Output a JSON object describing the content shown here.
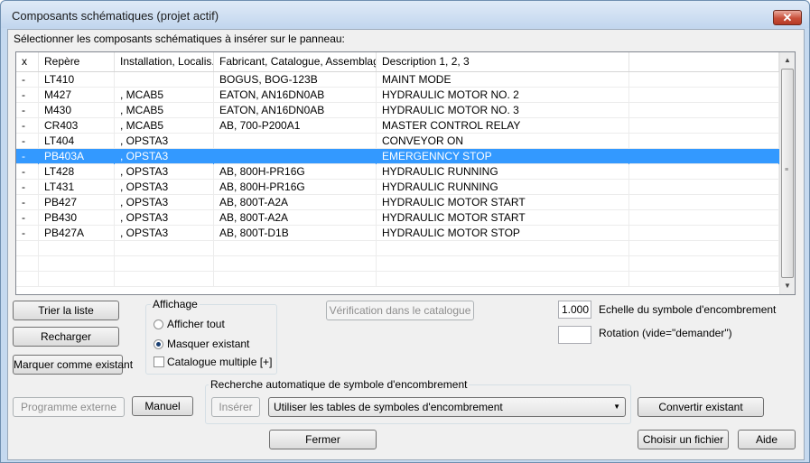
{
  "window": {
    "title": "Composants schématiques (projet actif)",
    "close_glyph": "✕"
  },
  "instruction": "Sélectionner les composants schématiques à insérer sur le panneau:",
  "table": {
    "columns": [
      "x",
      "Repère",
      "Installation, Localis...",
      "Fabricant, Catalogue, Assemblage",
      "Description 1, 2, 3",
      ""
    ],
    "rows": [
      [
        "-",
        "LT410",
        "",
        "BOGUS, BOG-123B",
        "MAINT MODE",
        ""
      ],
      [
        "-",
        "M427",
        ", MCAB5",
        "EATON, AN16DN0AB",
        "HYDRAULIC MOTOR NO. 2",
        ""
      ],
      [
        "-",
        "M430",
        ", MCAB5",
        "EATON, AN16DN0AB",
        "HYDRAULIC MOTOR NO. 3",
        ""
      ],
      [
        "-",
        "CR403",
        ", MCAB5",
        "AB, 700-P200A1",
        "MASTER CONTROL RELAY",
        ""
      ],
      [
        "-",
        "LT404",
        ", OPSTA3",
        "",
        "CONVEYOR ON",
        ""
      ],
      [
        "-",
        "PB403A",
        ", OPSTA3",
        "",
        "EMERGENNCY STOP",
        ""
      ],
      [
        "-",
        "LT428",
        ", OPSTA3",
        "AB, 800H-PR16G",
        "HYDRAULIC RUNNING",
        ""
      ],
      [
        "-",
        "LT431",
        ", OPSTA3",
        "AB, 800H-PR16G",
        "HYDRAULIC RUNNING",
        ""
      ],
      [
        "-",
        "PB427",
        ", OPSTA3",
        "AB, 800T-A2A",
        "HYDRAULIC MOTOR START",
        ""
      ],
      [
        "-",
        "PB430",
        ", OPSTA3",
        "AB, 800T-A2A",
        "HYDRAULIC MOTOR START",
        ""
      ],
      [
        "-",
        "PB427A",
        ", OPSTA3",
        "AB, 800T-D1B",
        "HYDRAULIC MOTOR STOP",
        ""
      ],
      [
        "",
        "",
        "",
        "",
        "",
        ""
      ],
      [
        "",
        "",
        "",
        "",
        "",
        ""
      ],
      [
        "",
        "",
        "",
        "",
        "",
        ""
      ]
    ],
    "selected_row": 5
  },
  "buttons": {
    "sort": "Trier la liste",
    "reload": "Recharger",
    "mark_existing": "Marquer comme existant",
    "catalog_check": "Vérification dans le catalogue",
    "external_program": "Programme externe",
    "manual": "Manuel",
    "insert": "Insérer",
    "convert_existing": "Convertir existant",
    "close": "Fermer",
    "choose_file": "Choisir un fichier",
    "help": "Aide"
  },
  "display_group": {
    "label": "Affichage",
    "show_all": "Afficher tout",
    "hide_existing": "Masquer existant",
    "multi_catalog": "Catalogue multiple [+]",
    "selected_option": "Masquer existant"
  },
  "scale": {
    "value": "1.000",
    "label": "Echelle du symbole d'encombrement"
  },
  "rotation": {
    "value": "",
    "label": "Rotation (vide=\"demander\")"
  },
  "auto_search": {
    "label": "Recherche automatique de symbole d'encombrement",
    "selected": "Utiliser les tables de symboles d'encombrement"
  },
  "icons": {
    "scroll_up": "▲",
    "scroll_down": "▼",
    "dropdown": "▼",
    "grip": "≡"
  }
}
